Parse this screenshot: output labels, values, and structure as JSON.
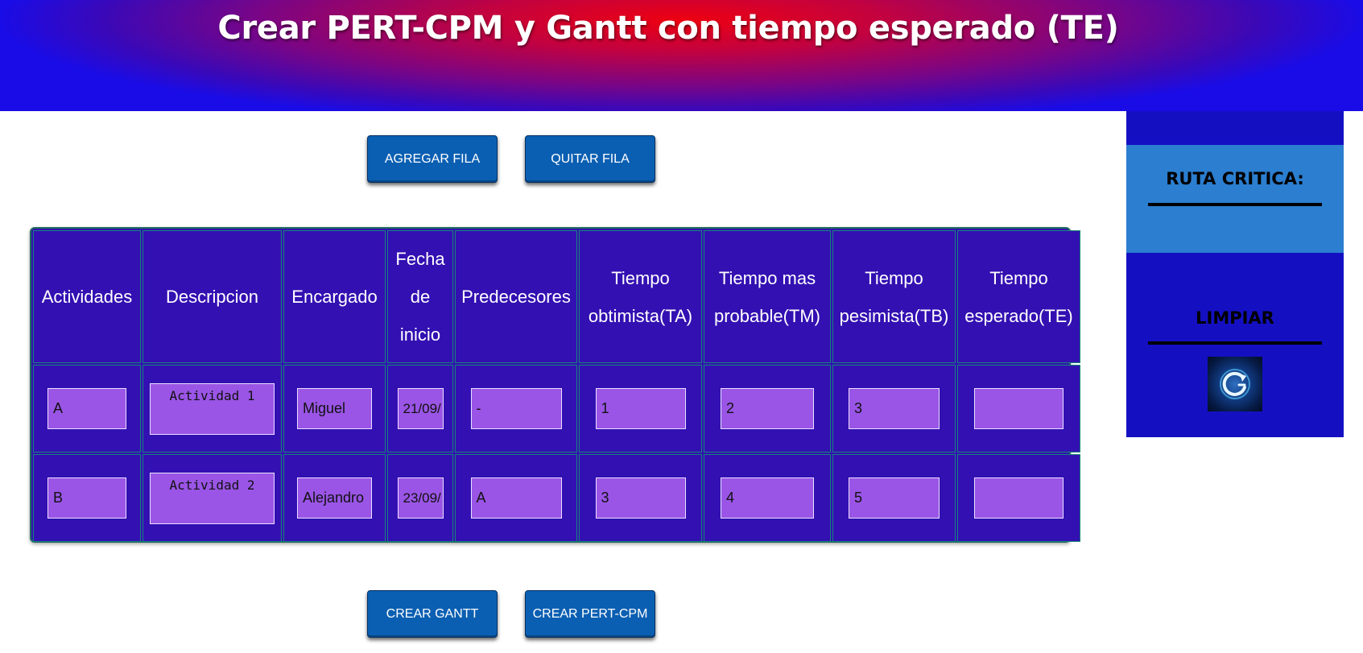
{
  "header": {
    "title": "Crear PERT-CPM y Gantt con tiempo esperado (TE)"
  },
  "toolbar": {
    "add_row_label": "AGREGAR FILA",
    "remove_row_label": "QUITAR FILA",
    "gantt_label": "CREAR GANTT",
    "pert_label": "CREAR PERT-CPM"
  },
  "table": {
    "columns": [
      "Actividades",
      "Descripcion",
      "Encargado",
      "Fecha de inicio",
      "Predecesores",
      "Tiempo obtimista(TA)",
      "Tiempo mas probable(TM)",
      "Tiempo pesimista(TB)",
      "Tiempo esperado(TE)"
    ],
    "rows": [
      {
        "actividad": "A",
        "descripcion": "Actividad 1",
        "encargado": "Miguel",
        "fecha": "21/09/",
        "predecesores": "-",
        "ta": "1",
        "tm": "2",
        "tb": "3",
        "te": ""
      },
      {
        "actividad": "B",
        "descripcion": "Actividad 2",
        "encargado": "Alejandro",
        "fecha": "23/09/",
        "predecesores": "A",
        "ta": "3",
        "tm": "4",
        "tb": "5",
        "te": ""
      }
    ]
  },
  "sidebar": {
    "ruta_label": "RUTA CRITICA:",
    "limpiar_label": "LIMPIAR",
    "logo_icon": "refresh-logo-icon"
  },
  "colors": {
    "header_red": "#ee0010",
    "header_blue": "#1a0ce6",
    "table_bg": "#3310b2",
    "input_bg": "#9a55e6",
    "button_bg": "#0b5fb2",
    "sidebar_bg": "#1410c2",
    "sidebar_highlight": "#2b7ed0"
  }
}
